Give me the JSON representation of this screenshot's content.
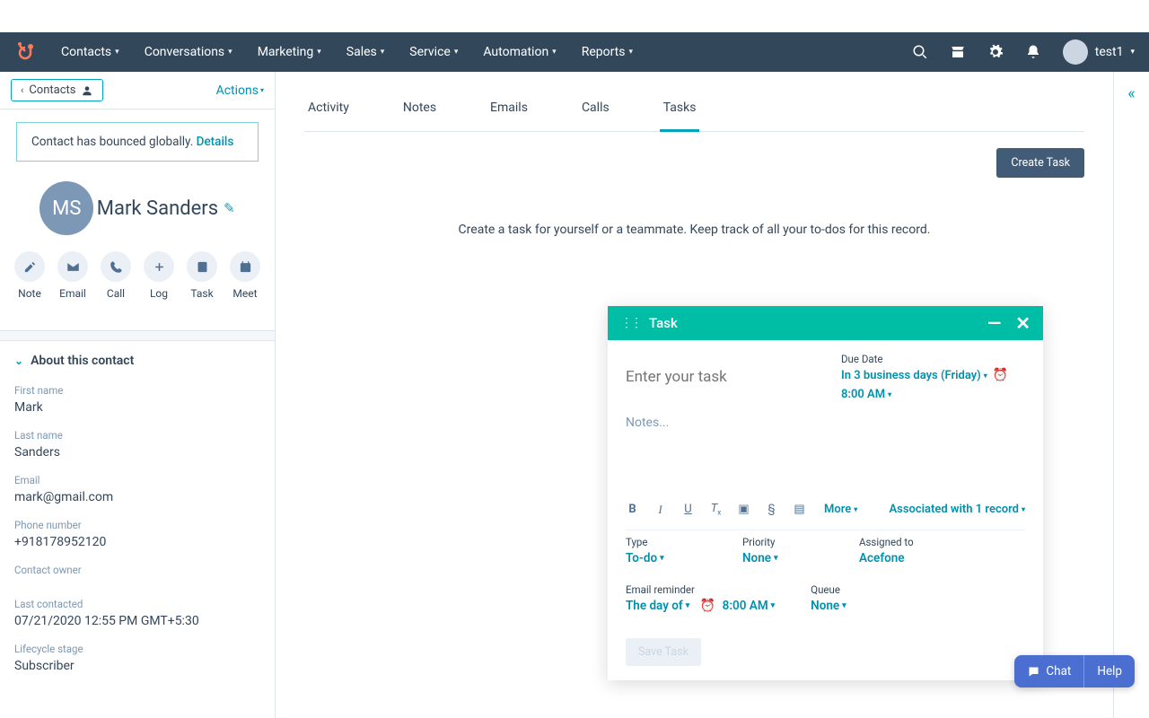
{
  "nav": {
    "items": [
      "Contacts",
      "Conversations",
      "Marketing",
      "Sales",
      "Service",
      "Automation",
      "Reports"
    ],
    "user_label": "test1"
  },
  "sidebar": {
    "back_label": "Contacts",
    "actions_label": "Actions",
    "alert_text": "Contact has bounced globally. ",
    "alert_link": "Details",
    "avatar_initials": "MS",
    "contact_name": "Mark Sanders",
    "actions": [
      {
        "key": "note",
        "label": "Note"
      },
      {
        "key": "email",
        "label": "Email"
      },
      {
        "key": "call",
        "label": "Call"
      },
      {
        "key": "log",
        "label": "Log"
      },
      {
        "key": "task",
        "label": "Task"
      },
      {
        "key": "meet",
        "label": "Meet"
      }
    ],
    "about_header": "About this contact",
    "fields": [
      {
        "label": "First name",
        "value": "Mark"
      },
      {
        "label": "Last name",
        "value": "Sanders"
      },
      {
        "label": "Email",
        "value": "mark@gmail.com"
      },
      {
        "label": "Phone number",
        "value": "+918178952120"
      },
      {
        "label": "Contact owner",
        "value": ""
      },
      {
        "label": "Last contacted",
        "value": "07/21/2020 12:55 PM GMT+5:30"
      },
      {
        "label": "Lifecycle stage",
        "value": "Subscriber"
      }
    ]
  },
  "tabs": [
    "Activity",
    "Notes",
    "Emails",
    "Calls",
    "Tasks"
  ],
  "active_tab_index": 4,
  "create_task_btn": "Create Task",
  "empty_state": "Create a task for yourself or a teammate. Keep track of all your to-dos for this record.",
  "task_panel": {
    "header": "Task",
    "title_placeholder": "Enter your task",
    "due_date_label": "Due Date",
    "due_date_value": "In 3 business days (Friday)",
    "due_time": "8:00 AM",
    "notes_placeholder": "Notes...",
    "more_label": "More",
    "associated_label": "Associated with 1 record",
    "fields": {
      "type": {
        "label": "Type",
        "value": "To-do"
      },
      "priority": {
        "label": "Priority",
        "value": "None"
      },
      "assigned": {
        "label": "Assigned to",
        "value": "Acefone"
      },
      "email_reminder": {
        "label": "Email reminder",
        "value": "The day of",
        "time": "8:00 AM"
      },
      "queue": {
        "label": "Queue",
        "value": "None"
      }
    },
    "save_btn": "Save Task"
  },
  "bottom": {
    "chat": "Chat",
    "help": "Help"
  }
}
